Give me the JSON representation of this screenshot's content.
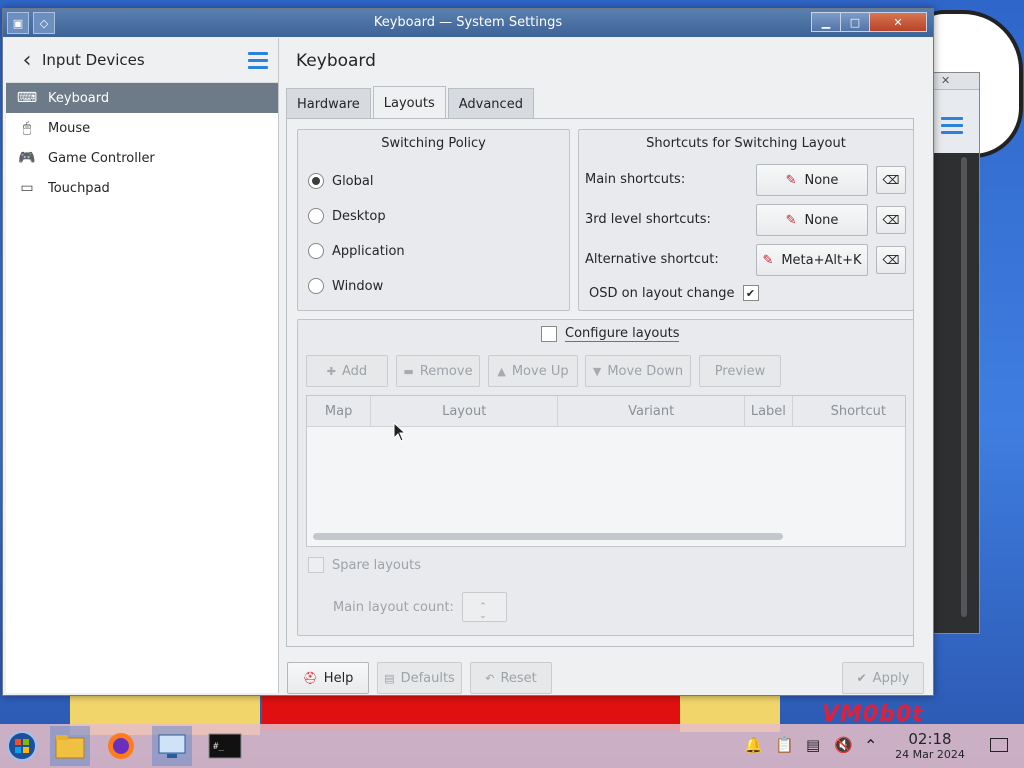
{
  "window": {
    "title": "Keyboard — System Settings"
  },
  "sidebar": {
    "title": "Input Devices",
    "items": [
      {
        "label": "Keyboard",
        "icon": "keyboard-icon",
        "active": true
      },
      {
        "label": "Mouse",
        "icon": "mouse-icon",
        "active": false
      },
      {
        "label": "Game Controller",
        "icon": "gamepad-icon",
        "active": false
      },
      {
        "label": "Touchpad",
        "icon": "touchpad-icon",
        "active": false
      }
    ]
  },
  "page": {
    "title": "Keyboard",
    "tabs": [
      {
        "label": "Hardware",
        "active": false
      },
      {
        "label": "Layouts",
        "active": true
      },
      {
        "label": "Advanced",
        "active": false
      }
    ]
  },
  "switching_policy": {
    "title": "Switching Policy",
    "options": [
      "Global",
      "Desktop",
      "Application",
      "Window"
    ],
    "selected": "Global"
  },
  "shortcuts": {
    "title": "Shortcuts for Switching Layout",
    "rows": [
      {
        "label": "Main shortcuts:",
        "value": "None"
      },
      {
        "label": "3rd level shortcuts:",
        "value": "None"
      },
      {
        "label": "Alternative shortcut:",
        "value": "Meta+Alt+K"
      }
    ],
    "osd_label": "OSD on layout change",
    "osd_checked": true
  },
  "layouts": {
    "configure_label": "Configure layouts",
    "configure_checked": false,
    "buttons": [
      "Add",
      "Remove",
      "Move Up",
      "Move Down",
      "Preview"
    ],
    "columns": [
      "Map",
      "Layout",
      "Variant",
      "Label",
      "Shortcut"
    ],
    "spare_label": "Spare layouts",
    "main_count_label": "Main layout count:"
  },
  "footer": {
    "help": "Help",
    "defaults": "Defaults",
    "reset": "Reset",
    "apply": "Apply"
  },
  "clock": {
    "time": "02:18",
    "date": "24 Mar 2024"
  },
  "wallpaper_text": "VM0b0t",
  "colors": {
    "accent": "#2a82da",
    "selected_sidebar": "#6d7a87",
    "titlebar": "#4a6fa3"
  }
}
